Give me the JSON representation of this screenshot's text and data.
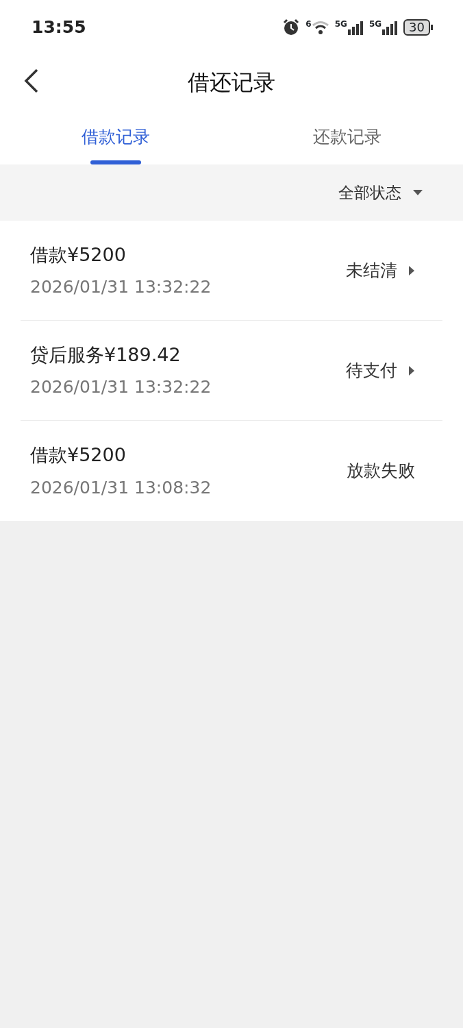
{
  "status_bar": {
    "time": "13:55",
    "wifi_label": "6",
    "signal_labels": [
      "5G",
      "5G"
    ],
    "battery": "30"
  },
  "header": {
    "title": "借还记录"
  },
  "tabs": [
    {
      "label": "借款记录",
      "selected": true
    },
    {
      "label": "还款记录",
      "selected": false
    }
  ],
  "filter": {
    "label": "全部状态"
  },
  "records": [
    {
      "title": "借款¥5200",
      "time": "2026/01/31 13:32:22",
      "status": "未结清",
      "has_arrow": true
    },
    {
      "title": "贷后服务¥189.42",
      "time": "2026/01/31 13:32:22",
      "status": "待支付",
      "has_arrow": true
    },
    {
      "title": "借款¥5200",
      "time": "2026/01/31 13:08:32",
      "status": "放款失败",
      "has_arrow": false
    }
  ]
}
